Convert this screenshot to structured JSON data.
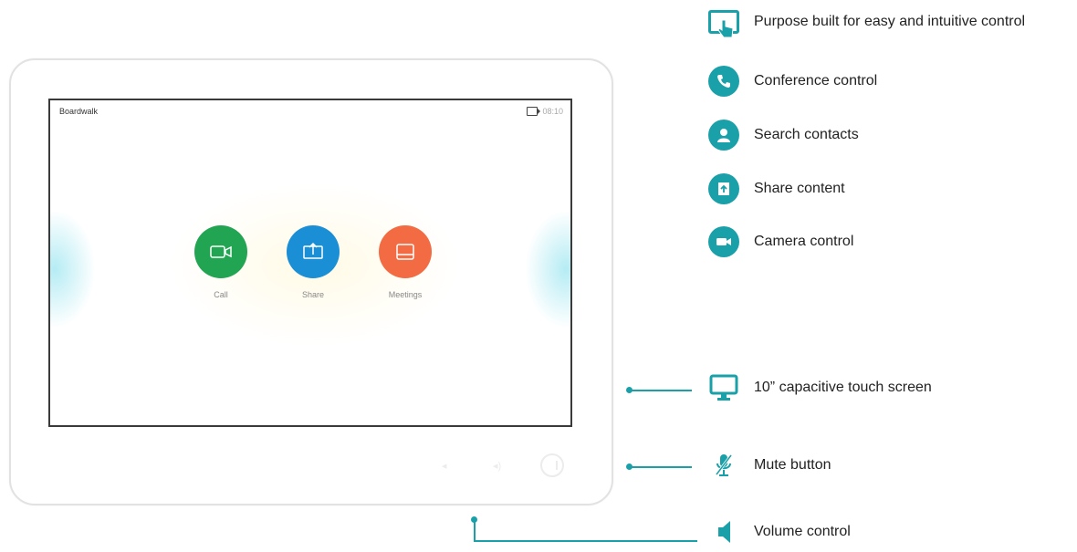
{
  "device": {
    "screen": {
      "title": "Boardwalk",
      "status": "08:10",
      "buttons": [
        {
          "label": "Call",
          "color": "#22a552",
          "icon": "video-camera-icon"
        },
        {
          "label": "Share",
          "color": "#1a8fd6",
          "icon": "share-screen-icon"
        },
        {
          "label": "Meetings",
          "color": "#f26b43",
          "icon": "calendar-icon"
        }
      ]
    }
  },
  "features": [
    {
      "label": "Purpose  built for easy and intuitive control",
      "icon": "touch-hand-icon"
    },
    {
      "label": "Conference control",
      "icon": "phone-icon"
    },
    {
      "label": "Search contacts",
      "icon": "person-icon"
    },
    {
      "label": "Share content",
      "icon": "share-icon"
    },
    {
      "label": "Camera control",
      "icon": "camera-icon"
    }
  ],
  "callouts": [
    {
      "label": "10” capacitive touch screen",
      "icon": "monitor-icon"
    },
    {
      "label": "Mute button",
      "icon": "mute-mic-icon"
    },
    {
      "label": "Volume control",
      "icon": "speaker-icon"
    }
  ],
  "colors": {
    "accent": "#1aa0a8",
    "call": "#22a552",
    "share": "#1a8fd6",
    "meetings": "#f26b43"
  }
}
